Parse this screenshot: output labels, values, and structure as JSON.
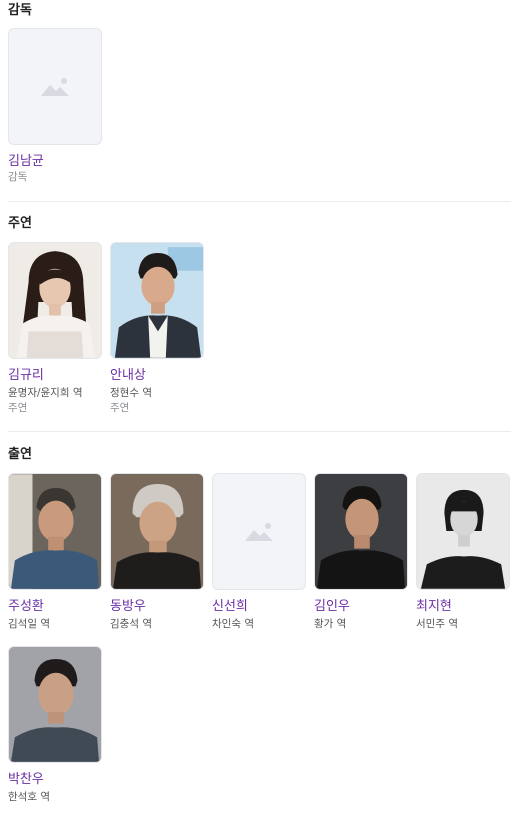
{
  "sections": {
    "director": {
      "title": "감독",
      "people": [
        {
          "name": "김남균",
          "role": "감독",
          "photo": "placeholder"
        }
      ]
    },
    "lead": {
      "title": "주연",
      "people": [
        {
          "name": "김규리",
          "role": "윤명자/윤지희 역",
          "sub": "주연",
          "photo": "portrait-woman-long-hair"
        },
        {
          "name": "안내상",
          "role": "정현수 역",
          "sub": "주연",
          "photo": "portrait-man-suit"
        }
      ]
    },
    "cast": {
      "title": "출연",
      "people": [
        {
          "name": "주성환",
          "role": "김석일 역",
          "photo": "portrait-man-older"
        },
        {
          "name": "동방우",
          "role": "김충석 역",
          "photo": "portrait-man-gray-hair"
        },
        {
          "name": "신선희",
          "role": "차인숙 역",
          "photo": "placeholder"
        },
        {
          "name": "김인우",
          "role": "황가 역",
          "photo": "portrait-man-dark"
        },
        {
          "name": "최지현",
          "role": "서민주 역",
          "photo": "portrait-woman-bw"
        },
        {
          "name": "박찬우",
          "role": "한석호 역",
          "photo": "portrait-man-young"
        }
      ]
    }
  },
  "colors": {
    "link": "#6b2fa3",
    "placeholder_bg": "#f3f4f7",
    "separator": "#e9ebee"
  }
}
